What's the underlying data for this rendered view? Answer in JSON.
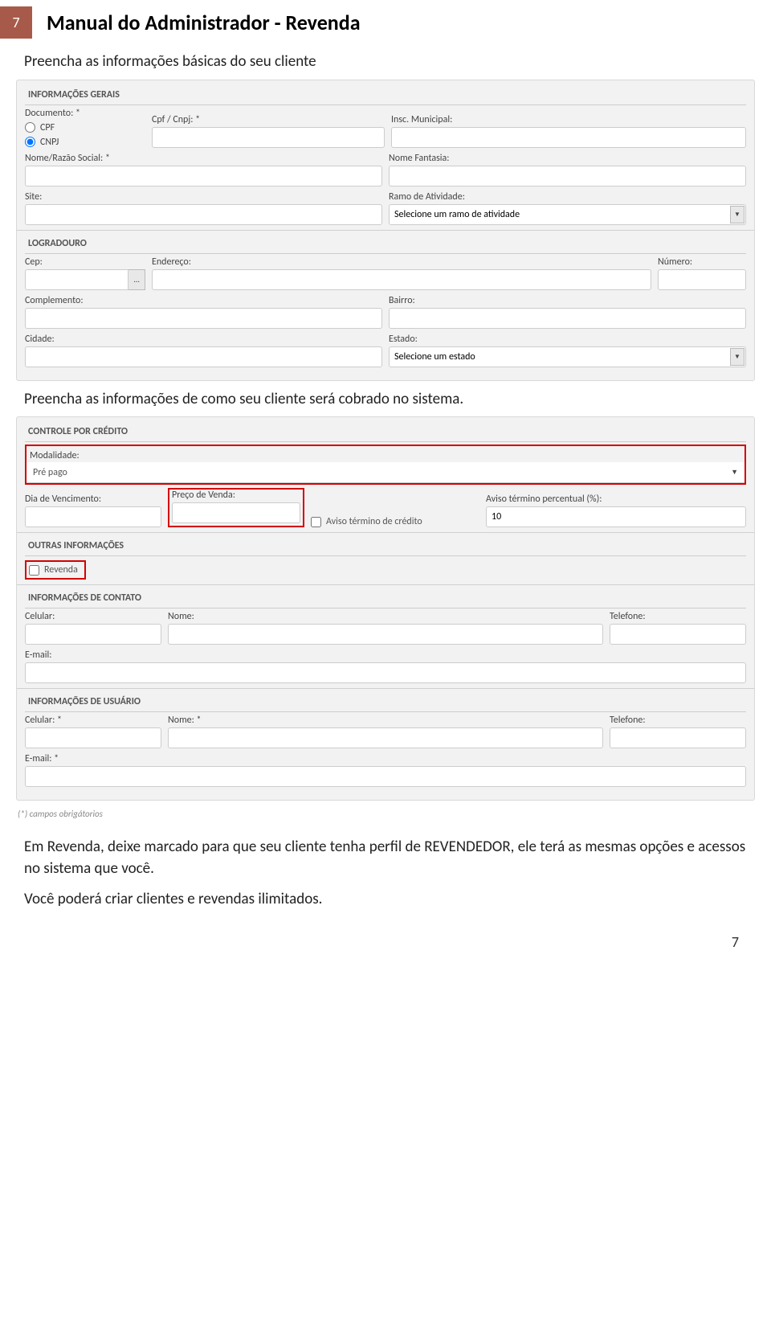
{
  "header": {
    "page_number": "7",
    "title": "Manual do Administrador - Revenda"
  },
  "intro1": "Preencha as informações básicas do seu cliente",
  "intro2": "Preencha as informações de como seu cliente será cobrado no sistema.",
  "form1": {
    "legend_gerais": "INFORMAÇÕES GERAIS",
    "documento_label": "Documento: *",
    "opt_cpf": "CPF",
    "opt_cnpj": "CNPJ",
    "cpf_cnpj_label": "Cpf / Cnpj: *",
    "insc_municipal_label": "Insc. Municipal:",
    "nome_razao_label": "Nome/Razão Social: *",
    "nome_fantasia_label": "Nome Fantasia:",
    "site_label": "Site:",
    "ramo_label": "Ramo de Atividade:",
    "ramo_placeholder": "Selecione um ramo de atividade",
    "legend_logradouro": "LOGRADOURO",
    "cep_label": "Cep:",
    "cep_btn": "…",
    "endereco_label": "Endereço:",
    "numero_label": "Número:",
    "complemento_label": "Complemento:",
    "bairro_label": "Bairro:",
    "cidade_label": "Cidade:",
    "estado_label": "Estado:",
    "estado_placeholder": "Selecione um estado"
  },
  "form2": {
    "legend_credito": "CONTROLE POR CRÉDITO",
    "modalidade_label": "Modalidade:",
    "modalidade_value": "Pré pago",
    "dia_venc_label": "Dia de Vencimento:",
    "preco_label": "Preço de Venda:",
    "aviso_check_label": "Aviso término de crédito",
    "aviso_perc_label": "Aviso término percentual (%):",
    "aviso_perc_value": "10",
    "legend_outras": "OUTRAS INFORMAÇÕES",
    "revenda_label": "Revenda",
    "legend_contato": "INFORMAÇÕES DE CONTATO",
    "celular_label": "Celular:",
    "nome_label": "Nome:",
    "telefone_label": "Telefone:",
    "email_label": "E-mail:",
    "legend_usuario": "INFORMAÇÕES DE USUÁRIO",
    "u_celular_label": "Celular: *",
    "u_nome_label": "Nome: *",
    "u_telefone_label": "Telefone:",
    "u_email_label": "E-mail: *"
  },
  "footnote": "(*) campos obrigátorios",
  "outro1": "Em Revenda, deixe marcado para que seu cliente tenha perfil de REVENDEDOR, ele terá as mesmas opções e acessos no sistema que você.",
  "outro2": "Você poderá criar clientes e revendas ilimitados.",
  "footer_page": "7"
}
